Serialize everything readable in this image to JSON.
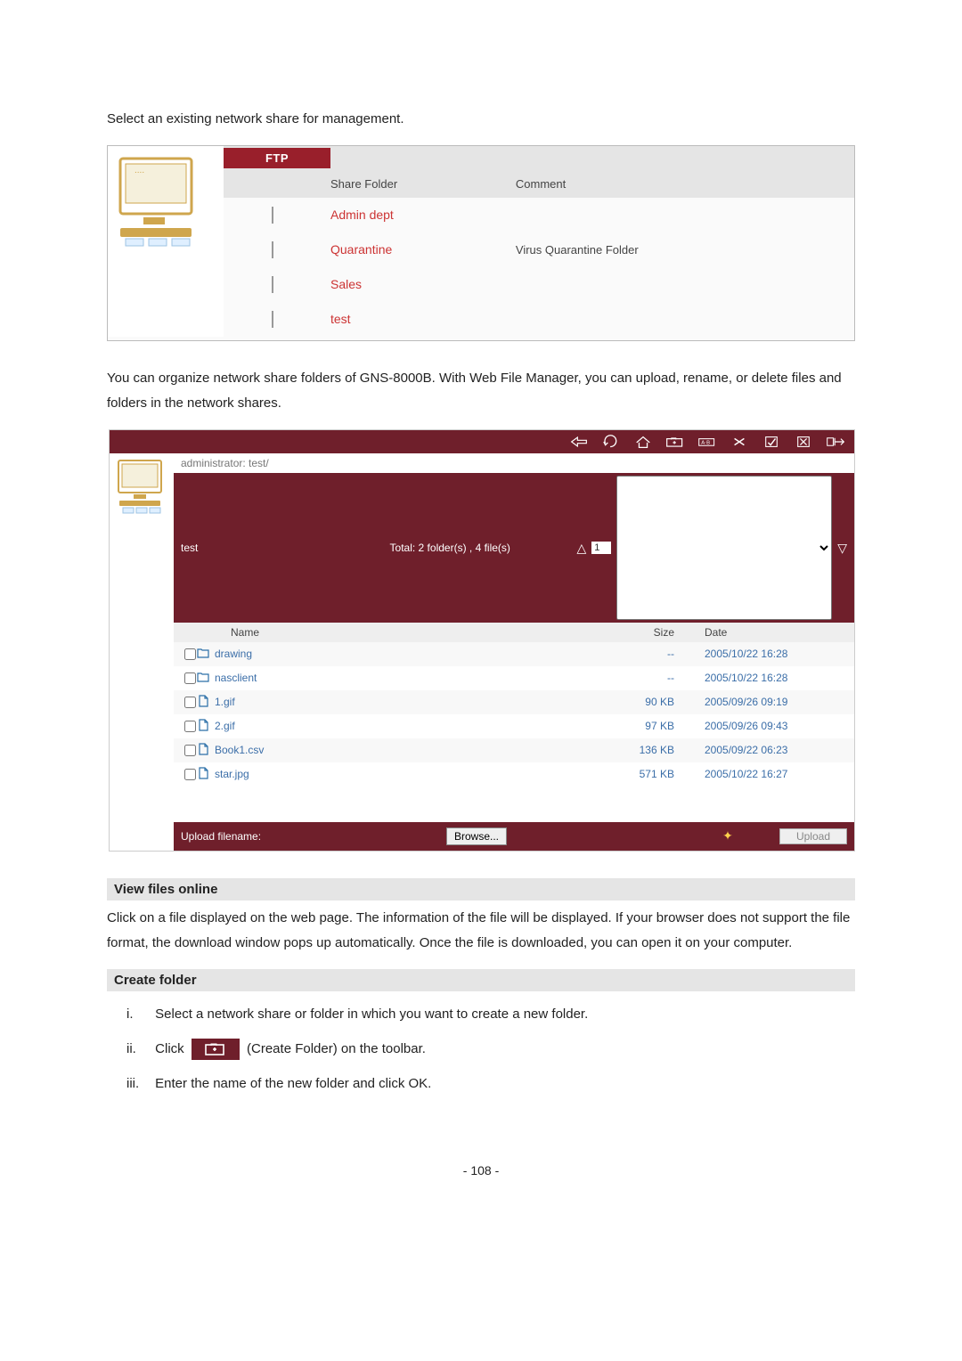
{
  "intro": "Select an existing network share for management.",
  "ftp": {
    "title": "FTP",
    "col_share": "Share Folder",
    "col_comment": "Comment",
    "rows": [
      {
        "name": "Admin dept",
        "comment": ""
      },
      {
        "name": "Quarantine",
        "comment": "Virus Quarantine Folder"
      },
      {
        "name": "Sales",
        "comment": ""
      },
      {
        "name": "test",
        "comment": ""
      }
    ]
  },
  "para2": "You can organize network share folders of GNS-8000B.  With Web File Manager, you can upload, rename, or delete files and folders in the network shares.",
  "fm": {
    "crumb": "administrator: test/",
    "current": "test",
    "summary": "Total: 2 folder(s) , 4 file(s)",
    "page_value": "1",
    "col_name": "Name",
    "col_size": "Size",
    "col_date": "Date",
    "rows": [
      {
        "type": "folder",
        "name": "drawing",
        "size": "--",
        "date": "2005/10/22 16:28"
      },
      {
        "type": "folder",
        "name": "nasclient",
        "size": "--",
        "date": "2005/10/22 16:28"
      },
      {
        "type": "file",
        "name": "1.gif",
        "size": "90 KB",
        "date": "2005/09/26 09:19"
      },
      {
        "type": "file",
        "name": "2.gif",
        "size": "97 KB",
        "date": "2005/09/26 09:43"
      },
      {
        "type": "file",
        "name": "Book1.csv",
        "size": "136 KB",
        "date": "2005/09/22 06:23"
      },
      {
        "type": "file",
        "name": "star.jpg",
        "size": "571 KB",
        "date": "2005/10/22 16:27"
      }
    ],
    "upload_label": "Upload filename:",
    "browse_btn": "Browse...",
    "upload_btn": "Upload"
  },
  "sec_view": {
    "title": "View files online",
    "body": "Click on a file displayed on the web page. The information of the file will be displayed.  If your browser does not support the file format, the download window pops up automatically.  Once the file is downloaded, you can open it on your computer."
  },
  "sec_create": {
    "title": "Create folder",
    "i_num": "i.",
    "i_text": "Select a network share or folder in which you want to create a new folder.",
    "ii_num": "ii.",
    "ii_before": "Click",
    "ii_after": "(Create Folder) on the toolbar.",
    "iii_num": "iii.",
    "iii_text": "Enter the name of the new folder and click OK."
  },
  "footer": "- 108 -"
}
